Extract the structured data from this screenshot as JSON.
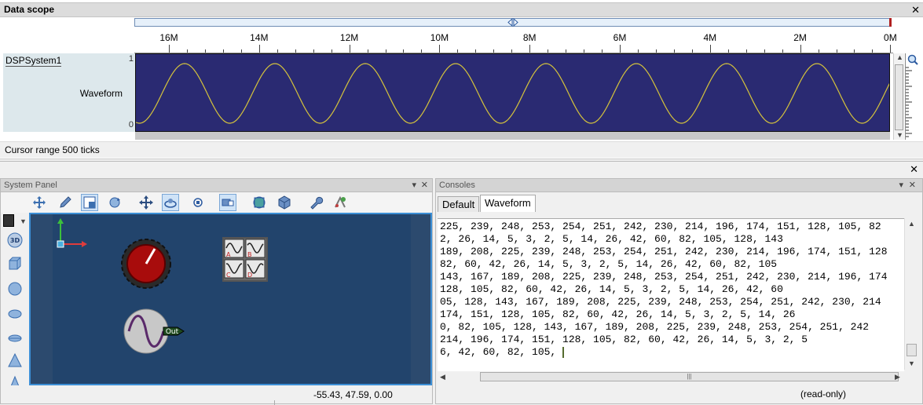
{
  "data_scope": {
    "title": "Data scope",
    "close": "✕",
    "ruler_ticks": [
      "16M",
      "14M",
      "12M",
      "10M",
      "8M",
      "6M",
      "4M",
      "2M",
      "0M"
    ],
    "track_name": "DSPSystem1",
    "signal_name": "Waveform",
    "axis_max": "1",
    "axis_min": "0",
    "wave_color": "#d4c23c",
    "wave_background": "#2a2a72",
    "status": "Cursor range 500 ticks"
  },
  "bottom_close": "✕",
  "system_panel": {
    "title": "System Panel",
    "pin": "▾",
    "close": "✕",
    "label_3d": "3D",
    "toolbar": [
      "move-icon",
      "pencil-icon",
      "select-icon",
      "rotate-icon",
      "pan-icon",
      "orbit-icon",
      "reset-view-icon",
      "frame-icon",
      "sphere-view-icon",
      "cube-view-icon",
      "wrench-icon",
      "component-icon"
    ],
    "shape_tools": [
      "3d-icon",
      "box-icon",
      "sphere-icon",
      "ellipsoid-icon",
      "disc-icon",
      "cone-icon",
      "pyramid-icon"
    ],
    "components": {
      "knob": "knob-icon",
      "scope_grid": [
        "A",
        "B",
        "C",
        "D"
      ],
      "generator_port": "Out"
    },
    "canvas_color": "#22446c",
    "coords": "-55.43, 47.59, 0.00"
  },
  "consoles": {
    "title": "Consoles",
    "pin": "▾",
    "close": "✕",
    "tabs": [
      "Default",
      "Waveform"
    ],
    "active_tab": "Waveform",
    "lines": [
      "225, 239, 248, 253, 254, 251, 242, 230, 214, 196, 174, 151, 128, 105, 82",
      "2, 26, 14, 5, 3, 2, 5, 14, 26, 42, 60, 82, 105, 128, 143",
      "189, 208, 225, 239, 248, 253, 254, 251, 242, 230, 214, 196, 174, 151, 128",
      "82, 60, 42, 26, 14, 5, 3, 2, 5, 14, 26, 42, 60, 82, 105",
      "143, 167, 189, 208, 225, 239, 248, 253, 254, 251, 242, 230, 214, 196, 174",
      "128, 105, 82, 60, 42, 26, 14, 5, 3, 2, 5, 14, 26, 42, 60",
      "05, 128, 143, 167, 189, 208, 225, 239, 248, 253, 254, 251, 242, 230, 214",
      "174, 151, 128, 105, 82, 60, 42, 26, 14, 5, 3, 2, 5, 14, 26",
      "0, 82, 105, 128, 143, 167, 189, 208, 225, 239, 248, 253, 254, 251, 242",
      "214, 196, 174, 151, 128, 105, 82, 60, 42, 26, 14, 5, 3, 2, 5",
      "6, 42, 60, 82, 105,"
    ],
    "status": "(read-only)"
  }
}
